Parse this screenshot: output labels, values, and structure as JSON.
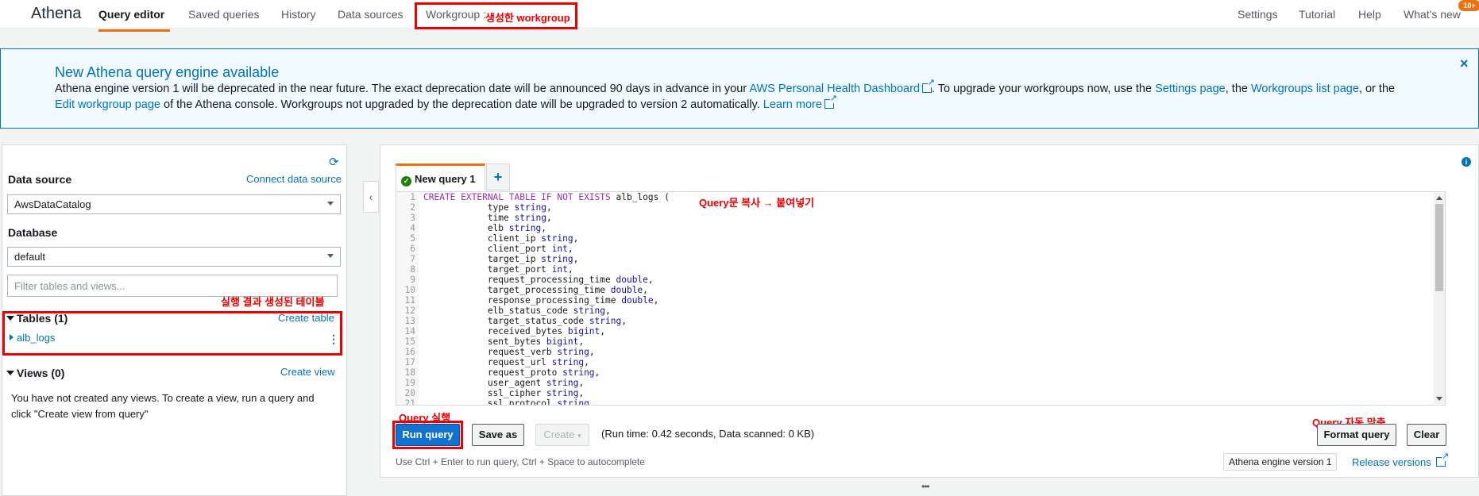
{
  "nav": {
    "brand": "Athena",
    "tabs": [
      "Query editor",
      "Saved queries",
      "History",
      "Data sources"
    ],
    "workgroup_label": "Workgroup :",
    "workgroup_note": "생성한 workgroup",
    "right": [
      "Settings",
      "Tutorial",
      "Help",
      "What's new"
    ],
    "badge": "10+"
  },
  "banner": {
    "title": "New Athena query engine available",
    "text_1": "Athena engine version 1 will be deprecated in the near future. The exact deprecation date will be announced 90 days in advance in your ",
    "link_1": "AWS Personal Health Dashboard",
    "text_2": ". To upgrade your workgroups now, use the ",
    "link_2": "Settings page",
    "text_3": ", the ",
    "link_3": "Workgroups list page",
    "text_4": ", or the ",
    "link_4": "Edit workgroup page",
    "text_5": " of the Athena console. Workgroups not upgraded by the deprecation date will be upgraded to version 2 automatically. ",
    "link_5": "Learn more",
    "close": "×"
  },
  "left": {
    "data_source_label": "Data source",
    "connect_link": "Connect data source",
    "data_source_value": "AwsDataCatalog",
    "database_label": "Database",
    "database_value": "default",
    "filter_placeholder": "Filter tables and views...",
    "tables_note": "실행 결과 생성된 테이블",
    "tables_header": "Tables (1)",
    "create_table": "Create table",
    "table_item": "alb_logs",
    "views_header": "Views (0)",
    "create_view": "Create view",
    "views_empty": "You have not created any views. To create a view, run a query and click \"Create view from query\""
  },
  "editor": {
    "tab_label": "New query 1",
    "add_tab": "+",
    "note": "Query문 복사 → 붙여넣기",
    "lines": [
      [
        {
          "t": "CREATE EXTERNAL TABLE IF NOT EXISTS",
          "c": "kw"
        },
        {
          "t": " alb_logs (",
          "c": ""
        }
      ],
      [
        {
          "t": "            type ",
          "c": ""
        },
        {
          "t": "string",
          "c": "ty"
        },
        {
          "t": ",",
          "c": ""
        }
      ],
      [
        {
          "t": "            time ",
          "c": ""
        },
        {
          "t": "string",
          "c": "ty"
        },
        {
          "t": ",",
          "c": ""
        }
      ],
      [
        {
          "t": "            elb ",
          "c": ""
        },
        {
          "t": "string",
          "c": "ty"
        },
        {
          "t": ",",
          "c": ""
        }
      ],
      [
        {
          "t": "            client_ip ",
          "c": ""
        },
        {
          "t": "string",
          "c": "ty"
        },
        {
          "t": ",",
          "c": ""
        }
      ],
      [
        {
          "t": "            client_port ",
          "c": ""
        },
        {
          "t": "int",
          "c": "ty"
        },
        {
          "t": ",",
          "c": ""
        }
      ],
      [
        {
          "t": "            target_ip ",
          "c": ""
        },
        {
          "t": "string",
          "c": "ty"
        },
        {
          "t": ",",
          "c": ""
        }
      ],
      [
        {
          "t": "            target_port ",
          "c": ""
        },
        {
          "t": "int",
          "c": "ty"
        },
        {
          "t": ",",
          "c": ""
        }
      ],
      [
        {
          "t": "            request_processing_time ",
          "c": ""
        },
        {
          "t": "double",
          "c": "ty"
        },
        {
          "t": ",",
          "c": ""
        }
      ],
      [
        {
          "t": "            target_processing_time ",
          "c": ""
        },
        {
          "t": "double",
          "c": "ty"
        },
        {
          "t": ",",
          "c": ""
        }
      ],
      [
        {
          "t": "            response_processing_time ",
          "c": ""
        },
        {
          "t": "double",
          "c": "ty"
        },
        {
          "t": ",",
          "c": ""
        }
      ],
      [
        {
          "t": "            elb_status_code ",
          "c": ""
        },
        {
          "t": "string",
          "c": "ty"
        },
        {
          "t": ",",
          "c": ""
        }
      ],
      [
        {
          "t": "            target_status_code ",
          "c": ""
        },
        {
          "t": "string",
          "c": "ty"
        },
        {
          "t": ",",
          "c": ""
        }
      ],
      [
        {
          "t": "            received_bytes ",
          "c": ""
        },
        {
          "t": "bigint",
          "c": "ty"
        },
        {
          "t": ",",
          "c": ""
        }
      ],
      [
        {
          "t": "            sent_bytes ",
          "c": ""
        },
        {
          "t": "bigint",
          "c": "ty"
        },
        {
          "t": ",",
          "c": ""
        }
      ],
      [
        {
          "t": "            request_verb ",
          "c": ""
        },
        {
          "t": "string",
          "c": "ty"
        },
        {
          "t": ",",
          "c": ""
        }
      ],
      [
        {
          "t": "            request_url ",
          "c": ""
        },
        {
          "t": "string",
          "c": "ty"
        },
        {
          "t": ",",
          "c": ""
        }
      ],
      [
        {
          "t": "            request_proto ",
          "c": ""
        },
        {
          "t": "string",
          "c": "ty"
        },
        {
          "t": ",",
          "c": ""
        }
      ],
      [
        {
          "t": "            user_agent ",
          "c": ""
        },
        {
          "t": "string",
          "c": "ty"
        },
        {
          "t": ",",
          "c": ""
        }
      ],
      [
        {
          "t": "            ssl_cipher ",
          "c": ""
        },
        {
          "t": "string",
          "c": "ty"
        },
        {
          "t": ",",
          "c": ""
        }
      ],
      [
        {
          "t": "            ssl_protocol ",
          "c": ""
        },
        {
          "t": "string",
          "c": "ty"
        }
      ]
    ]
  },
  "actions": {
    "run_note": "Query 실행",
    "run": "Run query",
    "save_as": "Save as",
    "create": "Create",
    "status": "(Run time: 0.42 seconds, Data scanned: 0 KB)",
    "format_note": "Query 자동 맞춤",
    "format": "Format query",
    "clear": "Clear",
    "hint": "Use Ctrl + Enter to run query, Ctrl + Space to autocomplete",
    "engine": "Athena engine version 1",
    "release": "Release versions",
    "drag": "•••"
  },
  "colors": {
    "accent": "#ec7211",
    "link": "#0073bb",
    "annotation": "#ee0000",
    "primary_button": "#1172d1"
  }
}
